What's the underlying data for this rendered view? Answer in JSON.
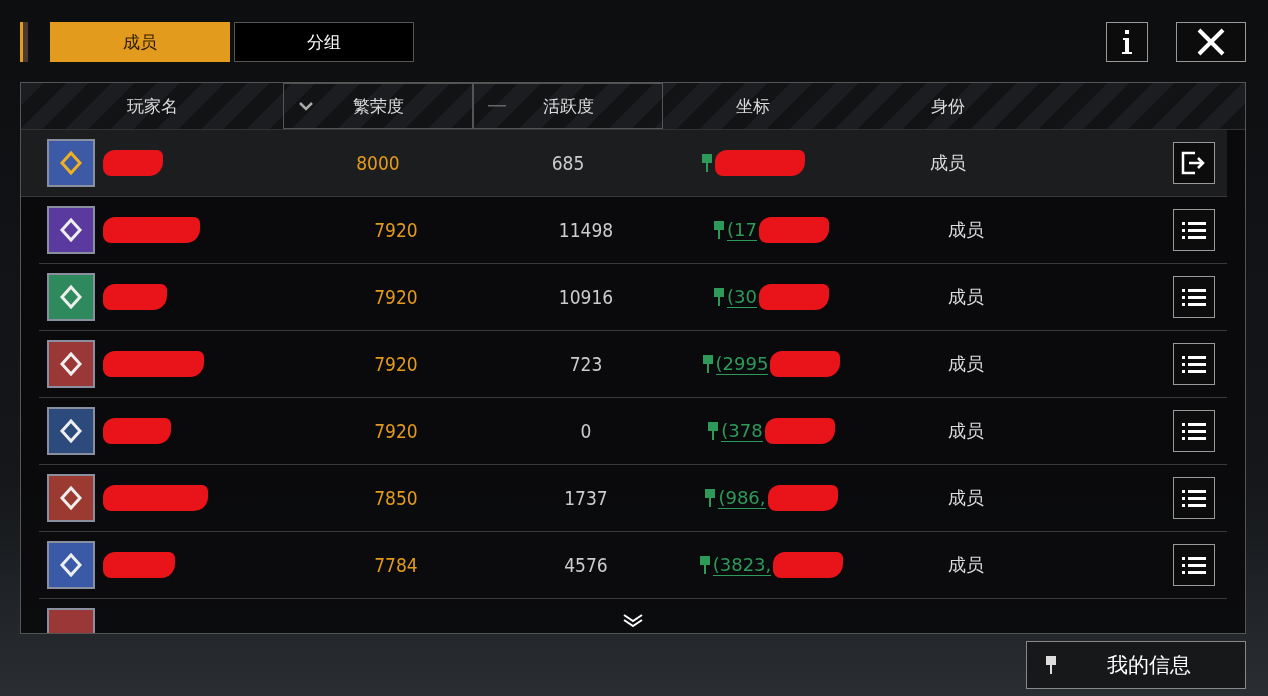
{
  "tabs": [
    {
      "label": "成员",
      "selected": true
    },
    {
      "label": "分组",
      "selected": false
    }
  ],
  "columns": [
    {
      "label": "玩家名",
      "kind": "plain"
    },
    {
      "label": "繁荣度",
      "kind": "sorted"
    },
    {
      "label": "活跃度",
      "kind": "sortable"
    },
    {
      "label": "坐标",
      "kind": "plain"
    },
    {
      "label": "身份",
      "kind": "plain"
    }
  ],
  "rows": [
    {
      "kind": "self",
      "color": "#3d5aa6",
      "prosperity": "8000",
      "activity": "685",
      "role": "成员"
    },
    {
      "kind": "member",
      "color": "#5a3a9e",
      "prosperity": "7920",
      "activity": "11498",
      "coord": "(17",
      "role": "成员"
    },
    {
      "kind": "member",
      "color": "#2e8a5c",
      "prosperity": "7920",
      "activity": "10916",
      "coord": "(30",
      "role": "成员"
    },
    {
      "kind": "member",
      "color": "#9a3838",
      "prosperity": "7920",
      "activity": "723",
      "coord": "(2995",
      "role": "成员"
    },
    {
      "kind": "member",
      "color": "#2c4a7c",
      "prosperity": "7920",
      "activity": "0",
      "coord": "(378",
      "role": "成员"
    },
    {
      "kind": "member",
      "color": "#9a3a30",
      "prosperity": "7850",
      "activity": "1737",
      "coord": "(986,",
      "role": "成员"
    },
    {
      "kind": "member",
      "color": "#3a5aa8",
      "prosperity": "7784",
      "activity": "4576",
      "coord": "(3823,",
      "role": "成员"
    },
    {
      "kind": "clipped",
      "color": "#9a3838"
    }
  ],
  "my_info_button": "我的信息"
}
